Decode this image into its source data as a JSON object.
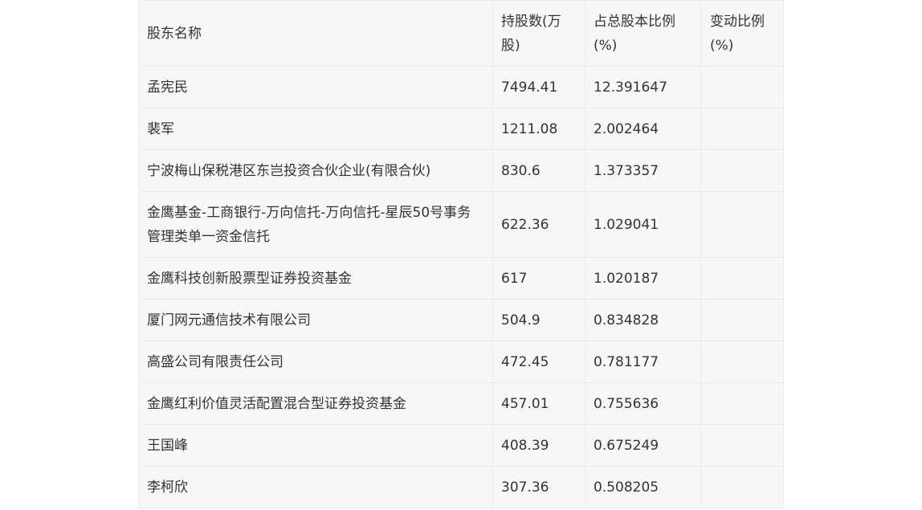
{
  "table": {
    "headers": [
      "股东名称",
      "持股数(万股)",
      "占总股本比例(%)",
      "变动比例(%)"
    ],
    "rows": [
      [
        "孟宪民",
        "7494.41",
        "12.391647",
        ""
      ],
      [
        "裴军",
        "1211.08",
        "2.002464",
        ""
      ],
      [
        "宁波梅山保税港区东岂投资合伙企业(有限合伙)",
        "830.6",
        "1.373357",
        ""
      ],
      [
        "金鹰基金-工商银行-万向信托-万向信托-星辰50号事务管理类单一资金信托",
        "622.36",
        "1.029041",
        ""
      ],
      [
        "金鹰科技创新股票型证券投资基金",
        "617",
        "1.020187",
        ""
      ],
      [
        "厦门网元通信技术有限公司",
        "504.9",
        "0.834828",
        ""
      ],
      [
        "高盛公司有限责任公司",
        "472.45",
        "0.781177",
        ""
      ],
      [
        "金鹰红利价值灵活配置混合型证券投资基金",
        "457.01",
        "0.755636",
        ""
      ],
      [
        "王国峰",
        "408.39",
        "0.675249",
        ""
      ],
      [
        "李柯欣",
        "307.36",
        "0.508205",
        ""
      ]
    ]
  }
}
